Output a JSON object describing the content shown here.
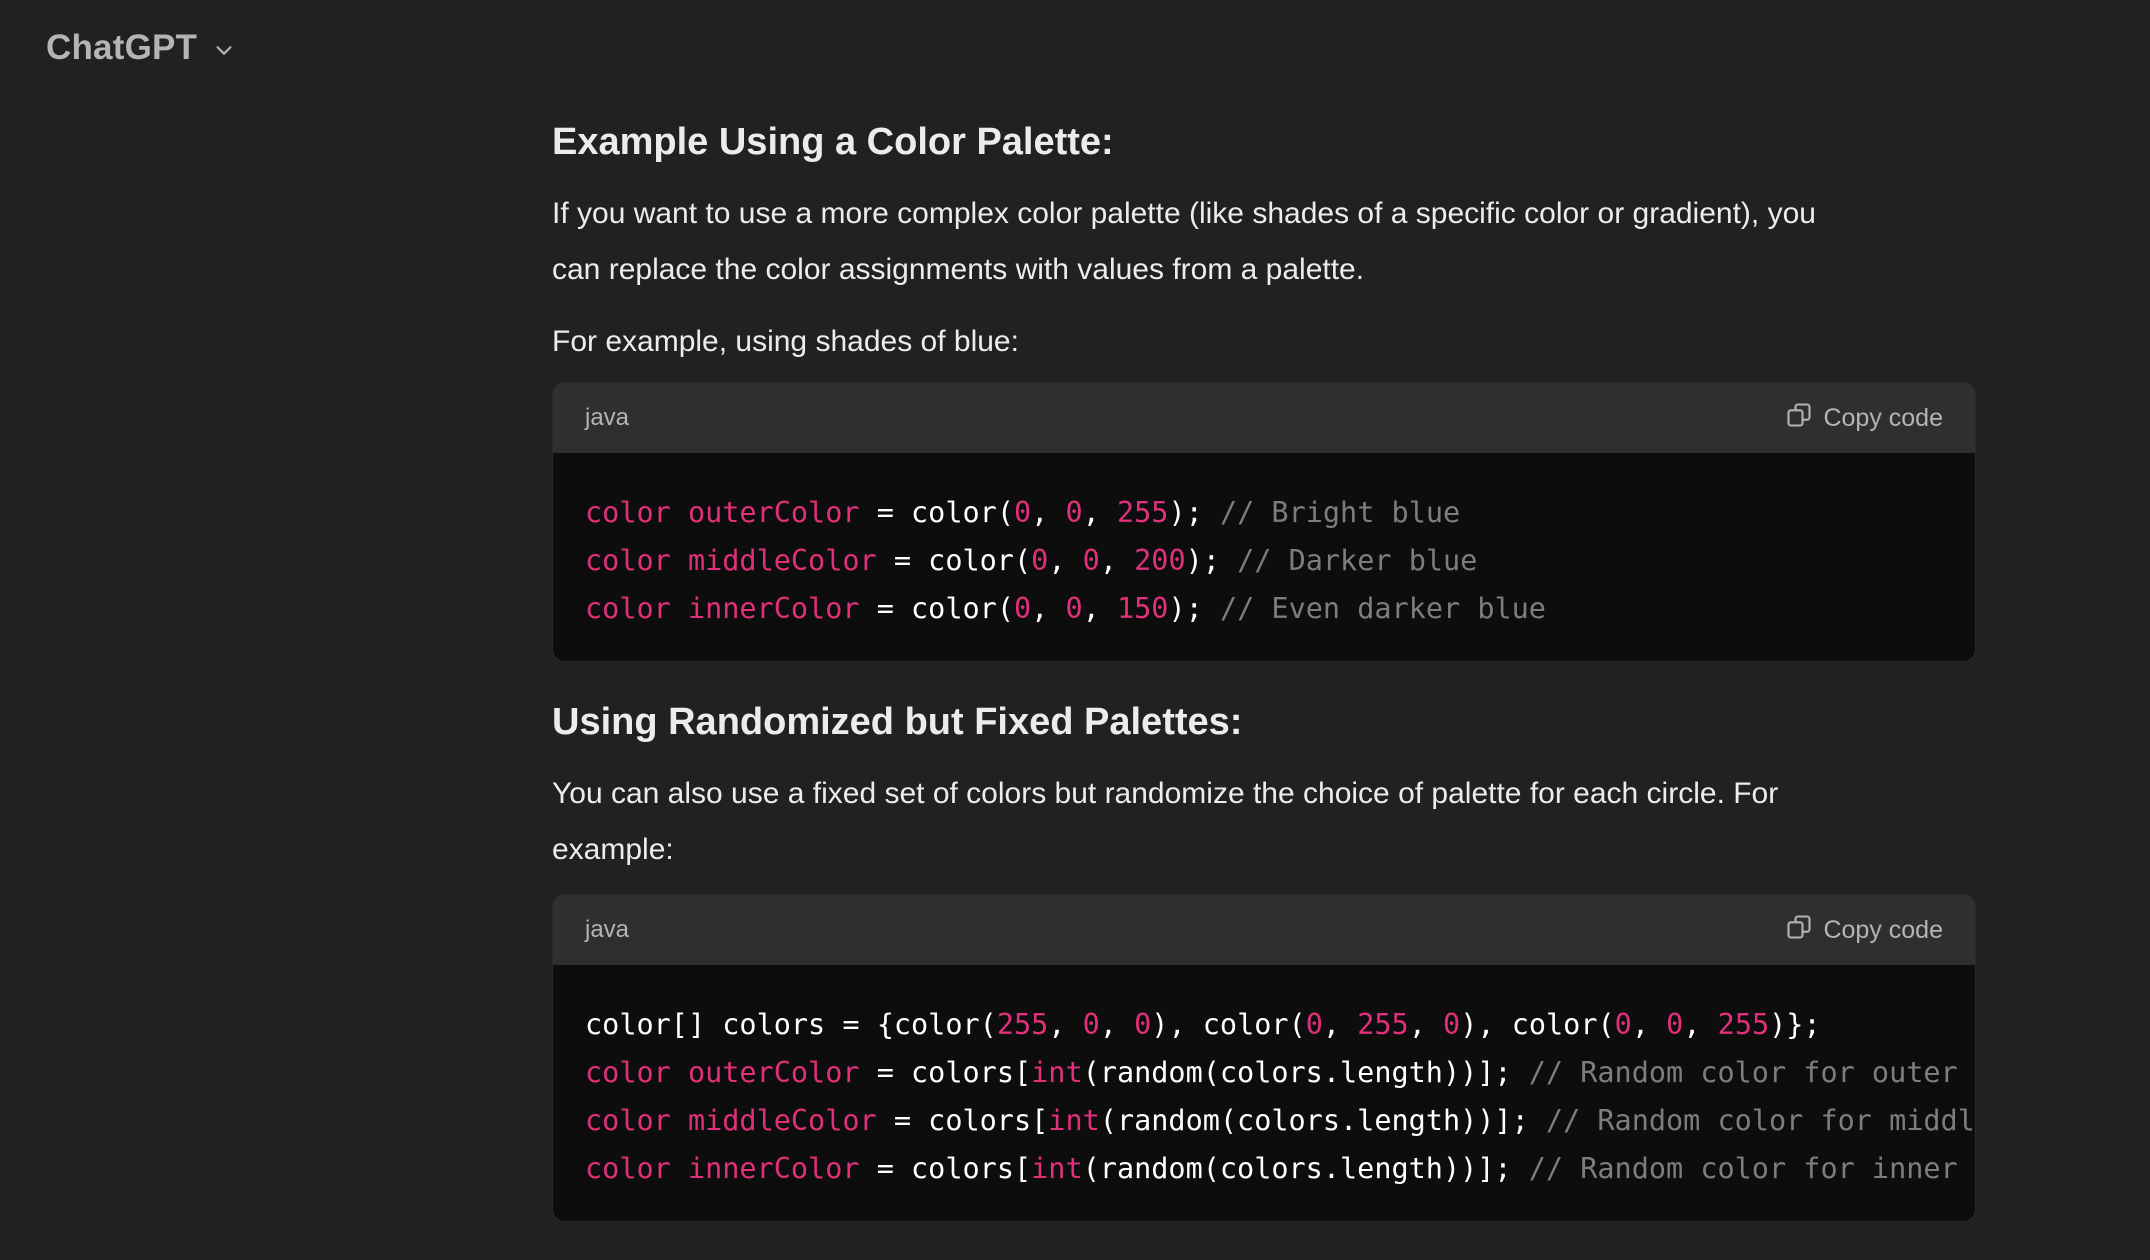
{
  "header": {
    "title": "ChatGPT",
    "dropdown_icon": "chevron-down-icon"
  },
  "section1": {
    "heading": "Example Using a Color Palette:",
    "para1_line1": "If you want to use a more complex color palette (like shades of a specific color or gradient), you",
    "para1_line2": "can replace the color assignments with values from a palette.",
    "para2": "For example, using shades of blue:",
    "code": {
      "language": "java",
      "copy_label": "Copy code",
      "lines": [
        [
          {
            "t": "color outerColor",
            "c": "kw"
          },
          {
            "t": " = color(",
            "c": "plain"
          },
          {
            "t": "0",
            "c": "num"
          },
          {
            "t": ", ",
            "c": "plain"
          },
          {
            "t": "0",
            "c": "num"
          },
          {
            "t": ", ",
            "c": "plain"
          },
          {
            "t": "255",
            "c": "num"
          },
          {
            "t": "); ",
            "c": "plain"
          },
          {
            "t": "// Bright blue",
            "c": "com"
          }
        ],
        [
          {
            "t": "color middleColor",
            "c": "kw"
          },
          {
            "t": " = color(",
            "c": "plain"
          },
          {
            "t": "0",
            "c": "num"
          },
          {
            "t": ", ",
            "c": "plain"
          },
          {
            "t": "0",
            "c": "num"
          },
          {
            "t": ", ",
            "c": "plain"
          },
          {
            "t": "200",
            "c": "num"
          },
          {
            "t": "); ",
            "c": "plain"
          },
          {
            "t": "// Darker blue",
            "c": "com"
          }
        ],
        [
          {
            "t": "color innerColor",
            "c": "kw"
          },
          {
            "t": " = color(",
            "c": "plain"
          },
          {
            "t": "0",
            "c": "num"
          },
          {
            "t": ", ",
            "c": "plain"
          },
          {
            "t": "0",
            "c": "num"
          },
          {
            "t": ", ",
            "c": "plain"
          },
          {
            "t": "150",
            "c": "num"
          },
          {
            "t": "); ",
            "c": "plain"
          },
          {
            "t": "// Even darker blue",
            "c": "com"
          }
        ]
      ]
    }
  },
  "section2": {
    "heading": "Using Randomized but Fixed Palettes:",
    "para1_line1": "You can also use a fixed set of colors but randomize the choice of palette for each circle. For",
    "para1_line2": "example:",
    "code": {
      "language": "java",
      "copy_label": "Copy code",
      "lines": [
        [
          {
            "t": "color[] colors = {color(",
            "c": "plain"
          },
          {
            "t": "255",
            "c": "num"
          },
          {
            "t": ", ",
            "c": "plain"
          },
          {
            "t": "0",
            "c": "num"
          },
          {
            "t": ", ",
            "c": "plain"
          },
          {
            "t": "0",
            "c": "num"
          },
          {
            "t": "), color(",
            "c": "plain"
          },
          {
            "t": "0",
            "c": "num"
          },
          {
            "t": ", ",
            "c": "plain"
          },
          {
            "t": "255",
            "c": "num"
          },
          {
            "t": ", ",
            "c": "plain"
          },
          {
            "t": "0",
            "c": "num"
          },
          {
            "t": "), color(",
            "c": "plain"
          },
          {
            "t": "0",
            "c": "num"
          },
          {
            "t": ", ",
            "c": "plain"
          },
          {
            "t": "0",
            "c": "num"
          },
          {
            "t": ", ",
            "c": "plain"
          },
          {
            "t": "255",
            "c": "num"
          },
          {
            "t": ")};",
            "c": "plain"
          }
        ],
        [
          {
            "t": "color outerColor",
            "c": "kw"
          },
          {
            "t": " = colors[",
            "c": "plain"
          },
          {
            "t": "int",
            "c": "kw"
          },
          {
            "t": "(random(colors.length))]; ",
            "c": "plain"
          },
          {
            "t": "// Random color for outer",
            "c": "com"
          }
        ],
        [
          {
            "t": "color middleColor",
            "c": "kw"
          },
          {
            "t": " = colors[",
            "c": "plain"
          },
          {
            "t": "int",
            "c": "kw"
          },
          {
            "t": "(random(colors.length))]; ",
            "c": "plain"
          },
          {
            "t": "// Random color for middl",
            "c": "com"
          }
        ],
        [
          {
            "t": "color innerColor",
            "c": "kw"
          },
          {
            "t": " = colors[",
            "c": "plain"
          },
          {
            "t": "int",
            "c": "kw"
          },
          {
            "t": "(random(colors.length))]; ",
            "c": "plain"
          },
          {
            "t": "// Random color for inner",
            "c": "com"
          }
        ]
      ]
    }
  },
  "colors": {
    "background": "#212121",
    "code_header": "#2f2f2f",
    "code_body": "#0d0d0d",
    "keyword": "#df3079",
    "comment": "#7d7d7d"
  }
}
